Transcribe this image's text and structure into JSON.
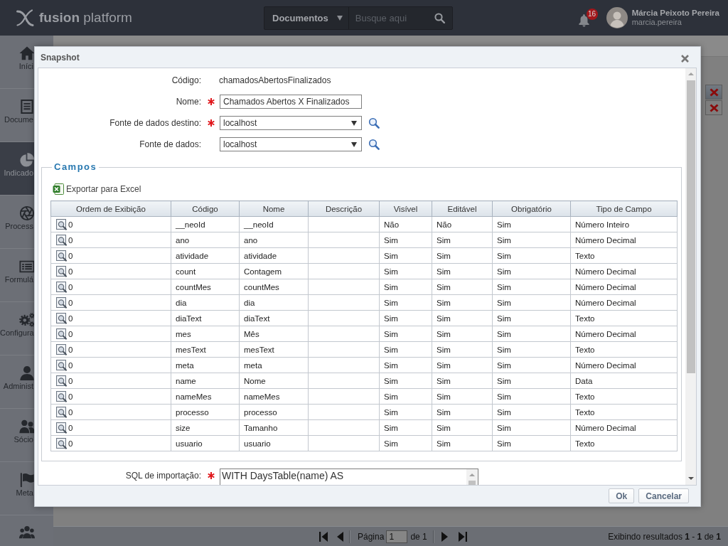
{
  "topbar": {
    "logo": "**fusion** platform",
    "search": {
      "scope": "Documentos",
      "placeholder": "Busque aqui"
    },
    "notifications": {
      "count": "16"
    },
    "user": {
      "name": "Márcia Peixoto Pereira",
      "login": "marcia.pereira"
    }
  },
  "sidebar": {
    "items": [
      {
        "kind": "home",
        "label": "Iníci",
        "selected": false
      },
      {
        "kind": "document",
        "label": "Docume",
        "selected": false
      },
      {
        "kind": "pie",
        "label": "Indicado",
        "selected": true
      },
      {
        "kind": "aperture",
        "label": "Process",
        "selected": false
      },
      {
        "kind": "form",
        "label": "Formulá",
        "selected": false
      },
      {
        "kind": "gears",
        "label": "Configura",
        "selected": false
      },
      {
        "kind": "person",
        "label": "Administ",
        "selected": false
      },
      {
        "kind": "people",
        "label": "Sócio",
        "selected": false
      },
      {
        "kind": "flag",
        "label": "Meta",
        "selected": false
      },
      {
        "kind": "group",
        "selected": false
      }
    ]
  },
  "background_table": {
    "rows": [
      {
        "selected": true
      },
      {
        "selected": false
      }
    ]
  },
  "dialog": {
    "title": "Snapshot",
    "fields": [
      {
        "kind": "text",
        "label": "Código:",
        "required": false,
        "value": "chamadosAbertosFinalizados"
      },
      {
        "kind": "input",
        "label": "Nome:",
        "required": true,
        "value": "Chamados Abertos X Finalizados"
      },
      {
        "kind": "select",
        "label": "Fonte de dados destino:",
        "required": true,
        "value": "localhost"
      },
      {
        "kind": "select",
        "label": "Fonte de dados:",
        "required": false,
        "value": "localhost"
      }
    ],
    "campos": {
      "legend": "Campos",
      "export_label": "Exportar para Excel",
      "columns": [
        "Ordem de Exibição",
        "Código",
        "Nome",
        "Descrição",
        "Visível",
        "Editável",
        "Obrigatório",
        "Tipo de Campo"
      ],
      "rows": [
        {
          "order": "0",
          "code": "__neoId",
          "name": "__neoId",
          "visible": "Não",
          "editable": "Não",
          "required": "Sim",
          "type": "Número Inteiro"
        },
        {
          "order": "0",
          "code": "ano",
          "name": "ano",
          "visible": "Sim",
          "editable": "Sim",
          "required": "Sim",
          "type": "Número Decimal"
        },
        {
          "order": "0",
          "code": "atividade",
          "name": "atividade",
          "visible": "Sim",
          "editable": "Sim",
          "required": "Sim",
          "type": "Texto"
        },
        {
          "order": "0",
          "code": "count",
          "name": "Contagem",
          "visible": "Sim",
          "editable": "Sim",
          "required": "Sim",
          "type": "Número Decimal"
        },
        {
          "order": "0",
          "code": "countMes",
          "name": "countMes",
          "visible": "Sim",
          "editable": "Sim",
          "required": "Sim",
          "type": "Número Decimal"
        },
        {
          "order": "0",
          "code": "dia",
          "name": "dia",
          "visible": "Sim",
          "editable": "Sim",
          "required": "Sim",
          "type": "Número Decimal"
        },
        {
          "order": "0",
          "code": "diaText",
          "name": "diaText",
          "visible": "Sim",
          "editable": "Sim",
          "required": "Sim",
          "type": "Texto"
        },
        {
          "order": "0",
          "code": "mes",
          "name": "Mês",
          "visible": "Sim",
          "editable": "Sim",
          "required": "Sim",
          "type": "Número Decimal"
        },
        {
          "order": "0",
          "code": "mesText",
          "name": "mesText",
          "visible": "Sim",
          "editable": "Sim",
          "required": "Sim",
          "type": "Texto"
        },
        {
          "order": "0",
          "code": "meta",
          "name": "meta",
          "visible": "Sim",
          "editable": "Sim",
          "required": "Sim",
          "type": "Número Decimal"
        },
        {
          "order": "0",
          "code": "name",
          "name": "Nome",
          "visible": "Sim",
          "editable": "Sim",
          "required": "Sim",
          "type": "Data"
        },
        {
          "order": "0",
          "code": "nameMes",
          "name": "nameMes",
          "visible": "Sim",
          "editable": "Sim",
          "required": "Sim",
          "type": "Texto"
        },
        {
          "order": "0",
          "code": "processo",
          "name": "processo",
          "visible": "Sim",
          "editable": "Sim",
          "required": "Sim",
          "type": "Texto"
        },
        {
          "order": "0",
          "code": "size",
          "name": "Tamanho",
          "visible": "Sim",
          "editable": "Sim",
          "required": "Sim",
          "type": "Número Decimal"
        },
        {
          "order": "0",
          "code": "usuario",
          "name": "usuario",
          "visible": "Sim",
          "editable": "Sim",
          "required": "Sim",
          "type": "Texto"
        }
      ]
    },
    "sql": {
      "label": "SQL de importação:",
      "required": true,
      "value": "WITH DaysTable(name) AS"
    },
    "buttons": [
      "Ok",
      "Cancelar"
    ]
  },
  "pager": {
    "page_label": "Página",
    "page": "1",
    "total_label": "de 1",
    "summary": "Exibindo resultados **1** - **1** de **1**"
  }
}
